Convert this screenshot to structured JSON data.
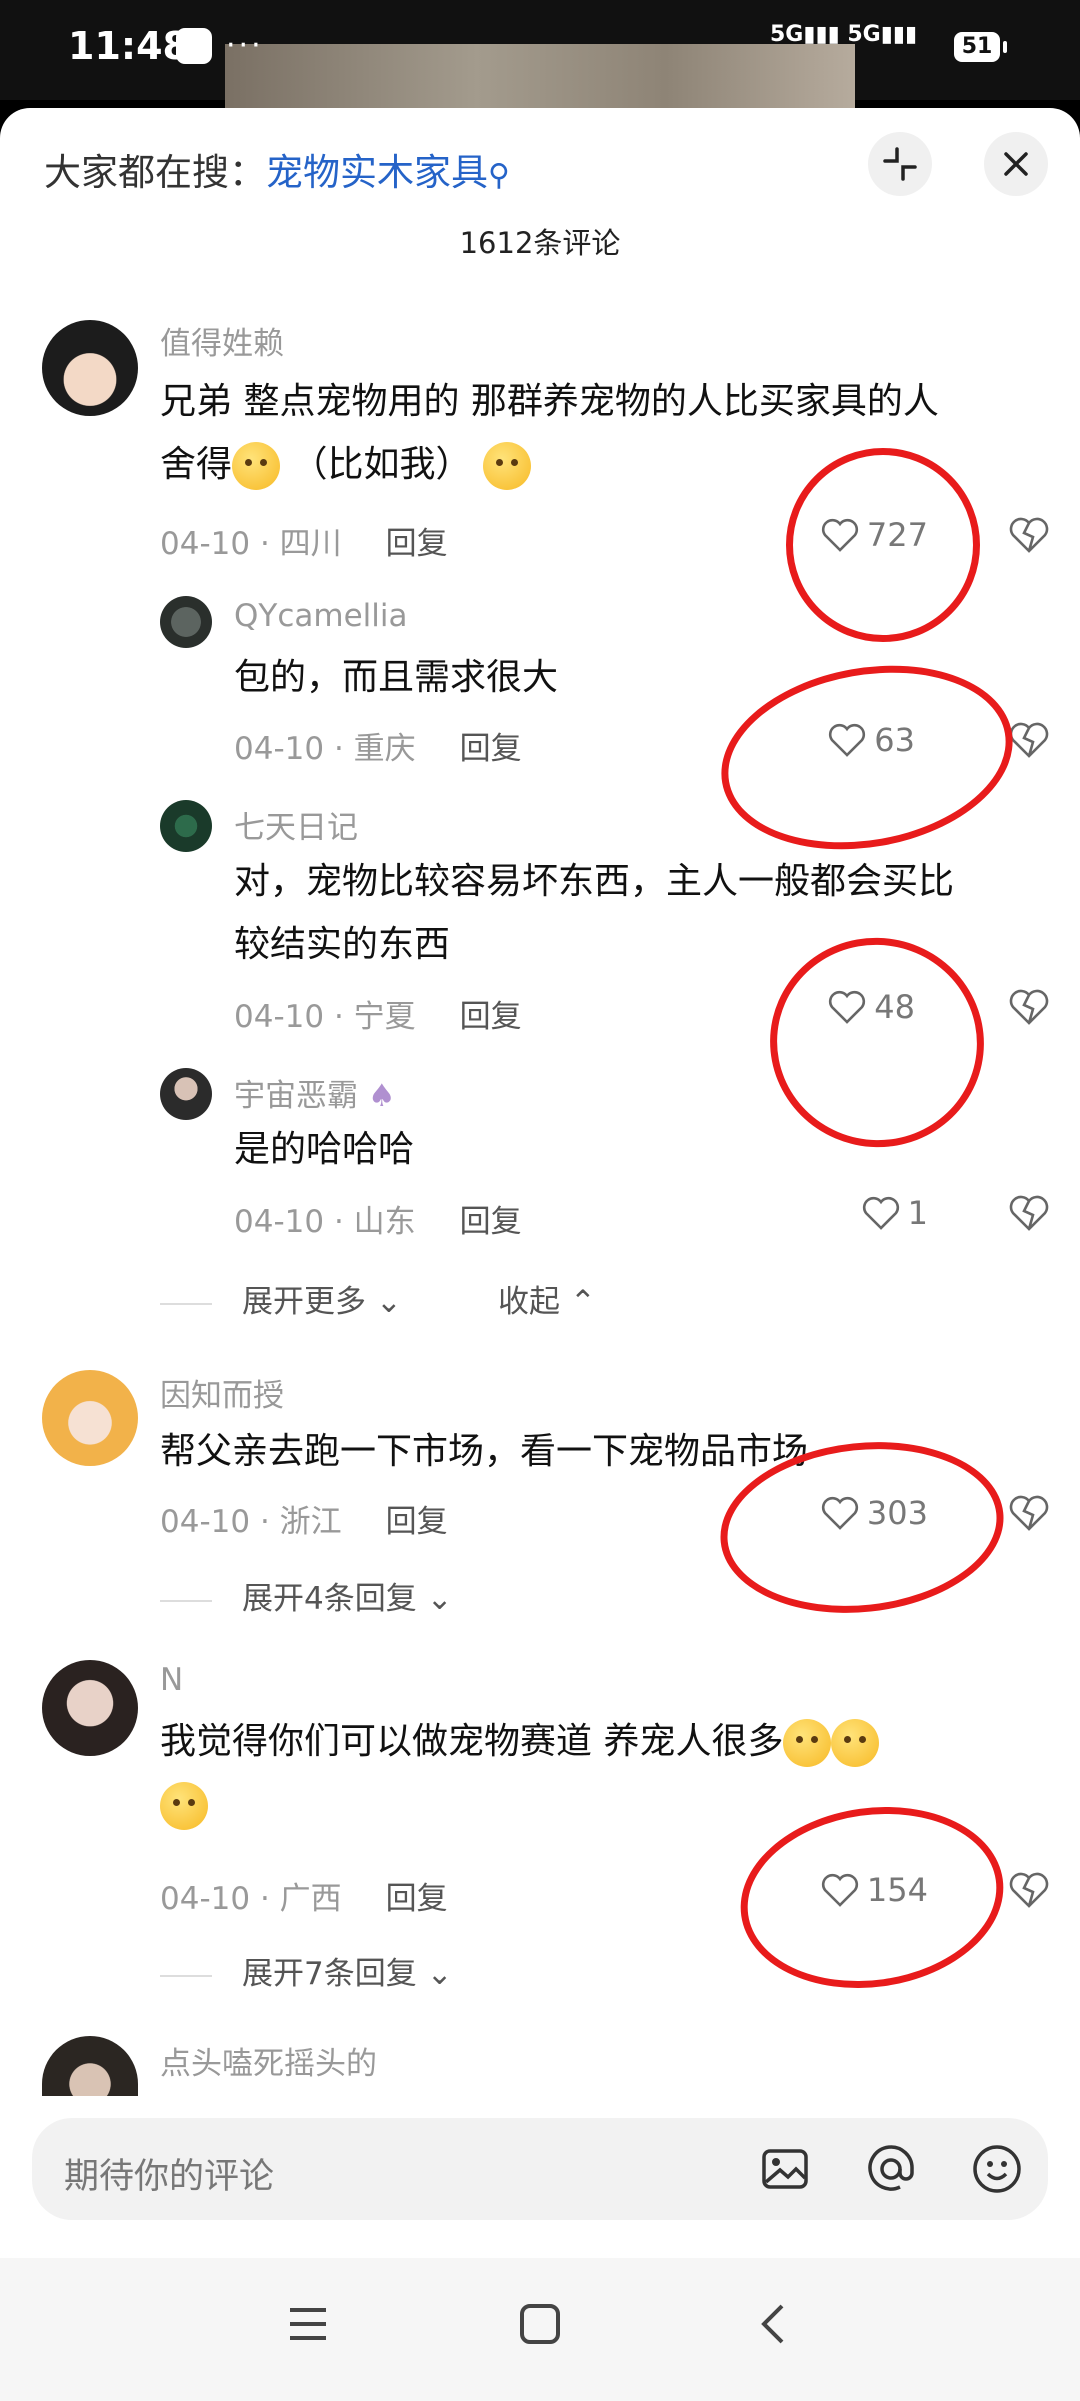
{
  "status_bar": {
    "time": "11:48",
    "network_a": "5G",
    "network_b": "5G",
    "battery": "51"
  },
  "header": {
    "search_prefix": "大家都在搜：",
    "search_keyword": "宠物实木家具",
    "comment_count": "1612条评论"
  },
  "comments": [
    {
      "user": "值得姓赖",
      "text_line1": "兄弟 整点宠物用的 那群养宠物的人比买家具的人",
      "text_line2_a": "舍得",
      "text_line2_b": "（比如我）",
      "date": "04-10",
      "location": "四川",
      "reply": "回复",
      "likes": "727",
      "replies": [
        {
          "user": "QYcamellia",
          "text": "包的，而且需求很大",
          "date": "04-10",
          "location": "重庆",
          "reply": "回复",
          "likes": "63"
        },
        {
          "user": "七天日记",
          "text_line1": "对，宠物比较容易坏东西，主人一般都会买比",
          "text_line2": "较结实的东西",
          "date": "04-10",
          "location": "宁夏",
          "reply": "回复",
          "likes": "48"
        },
        {
          "user": "宇宙恶霸",
          "text": "是的哈哈哈",
          "date": "04-10",
          "location": "山东",
          "reply": "回复",
          "likes": "1"
        }
      ],
      "expand_more": "展开更多",
      "collapse": "收起"
    },
    {
      "user": "因知而授",
      "text": "帮父亲去跑一下市场，看一下宠物品市场",
      "date": "04-10",
      "location": "浙江",
      "reply": "回复",
      "likes": "303",
      "expand": "展开4条回复"
    },
    {
      "user": "N",
      "text": "我觉得你们可以做宠物赛道   养宠人很多",
      "date": "04-10",
      "location": "广西",
      "reply": "回复",
      "likes": "154",
      "expand": "展开7条回复"
    },
    {
      "user": "点头嗑死摇头的"
    }
  ],
  "input": {
    "placeholder": "期待你的评论"
  },
  "colors": {
    "accent": "#2563c8",
    "annotation": "#e81b1b"
  },
  "icons": [
    "heart-icon",
    "broken-heart-icon",
    "image-icon",
    "at-icon",
    "emoji-icon",
    "collapse-icon",
    "close-icon",
    "search-icon"
  ]
}
